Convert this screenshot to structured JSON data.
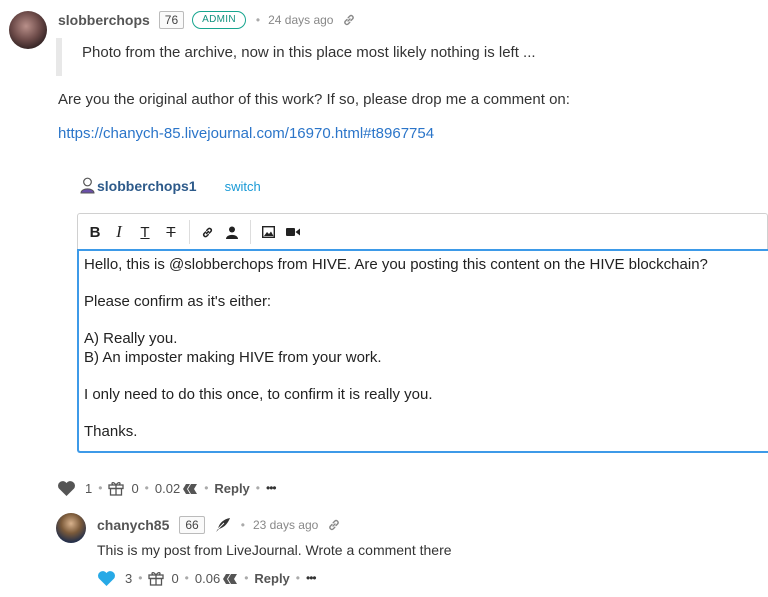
{
  "comment": {
    "username": "slobberchops",
    "reputation": "76",
    "badge": "ADMIN",
    "time": "24 days ago",
    "quote": "Photo from the archive, now in this place most likely nothing is left ...",
    "question": "Are you the original author of this work? If so, please drop me a comment on:",
    "link": "https://chanych-85.livejournal.com/16970.html#t8967754"
  },
  "reply_box": {
    "account": "slobberchops1",
    "switch_label": "switch",
    "editor_lines": [
      "Hello, this is @slobberchops from HIVE. Are you posting this content on the HIVE blockchain?",
      "Please confirm as it's either:",
      "A) Really you.",
      "B) An imposter making HIVE from your work.",
      "I only need to do this once, to confirm it is really you.",
      "Thanks."
    ],
    "toolbar": [
      "bold",
      "italic",
      "heading",
      "strikethrough",
      "link",
      "user",
      "image",
      "video"
    ]
  },
  "actions_main": {
    "votes": "1",
    "gifts": "0",
    "payout": "0.02",
    "reply_label": "Reply",
    "more": "•••"
  },
  "reply": {
    "username": "chanych85",
    "reputation": "66",
    "time": "23 days ago",
    "text": "This is my post from LiveJournal. Wrote a comment there",
    "votes": "3",
    "gifts": "0",
    "payout": "0.06",
    "reply_label": "Reply",
    "more": "•••"
  },
  "colors": {
    "accent_blue": "#1a9ad6",
    "editor_border": "#3d9ae8",
    "admin_badge": "#17a58f",
    "heart_liked": "#27a9e6",
    "link": "#2b75c9"
  }
}
